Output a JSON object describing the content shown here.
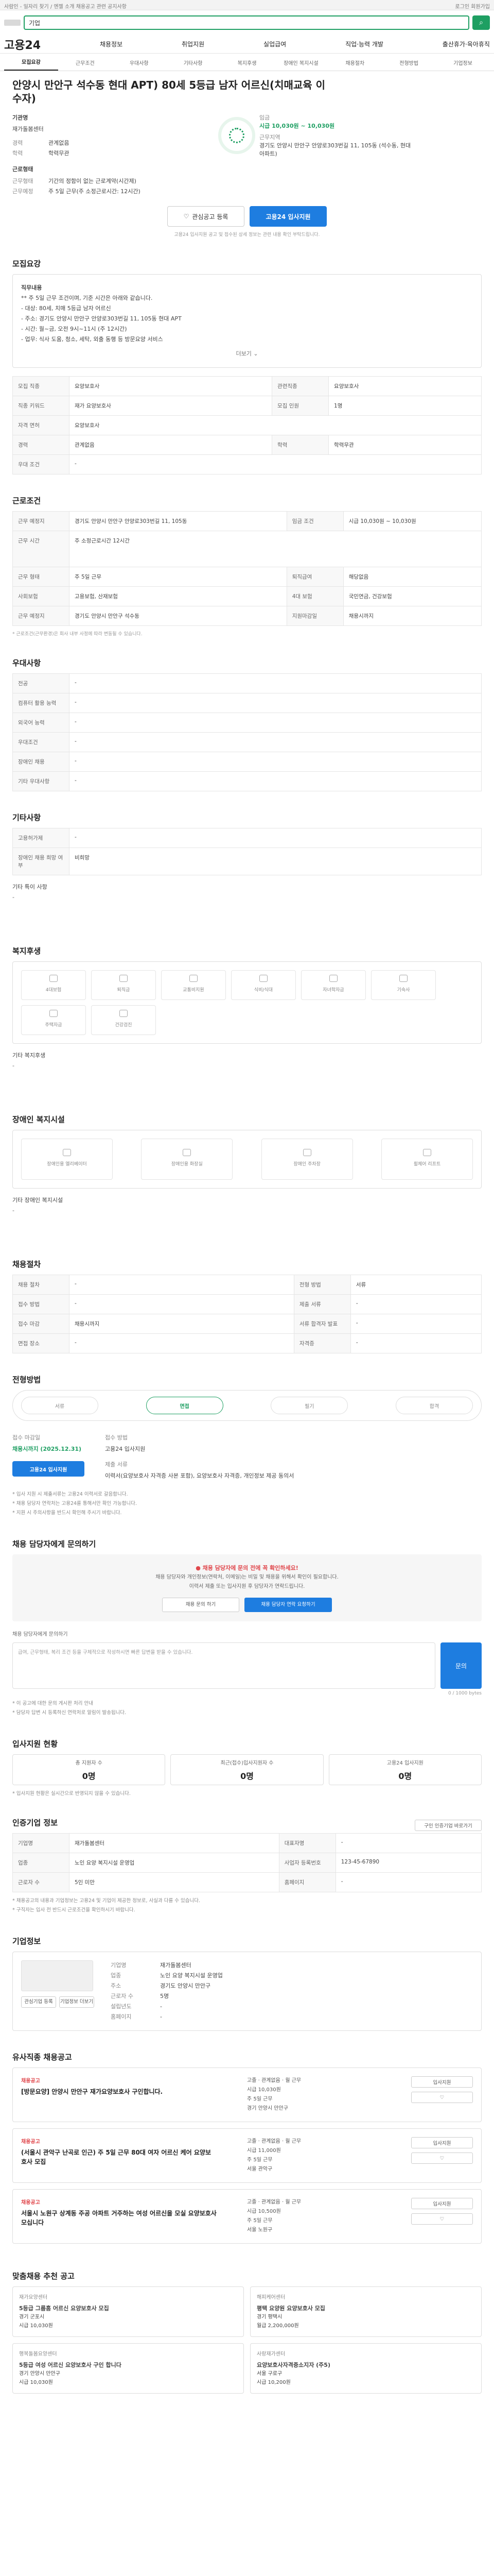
{
  "topbar": {
    "left": "사람인 - 일자리 찾기 / 엔젤 소개 채용공고 관련 공지사항",
    "right": "로그인  회원가입"
  },
  "search": {
    "placeholder": "기업",
    "button": "검색"
  },
  "gnb": {
    "brand": "고용24",
    "items": [
      "채용정보",
      "취업지원",
      "실업급여",
      "직업·능력 개발",
      "출산휴가·육아휴직"
    ]
  },
  "tabs": [
    {
      "label": "모집요강",
      "active": true
    },
    {
      "label": "근무조건",
      "active": false
    },
    {
      "label": "우대사항",
      "active": false
    },
    {
      "label": "기타사항",
      "active": false
    },
    {
      "label": "복지후생",
      "active": false
    },
    {
      "label": "장애인 복지시설",
      "active": false
    },
    {
      "label": "채용절차",
      "active": false
    },
    {
      "label": "전형방법",
      "active": false
    },
    {
      "label": "기업정보",
      "active": false
    }
  ],
  "header": {
    "title": "안양시 만안구 석수동 현대 APT) 80세 5등급 남자 어르신(치매교육 이수자)",
    "company_label": "기관명",
    "company_value": "재가돌봄센터",
    "rows": [
      {
        "k": "경력",
        "v": "관계없음"
      },
      {
        "k": "학력",
        "v": "학력무관"
      }
    ],
    "emp_label": "근로형태",
    "emp_rows": [
      {
        "k": "근무형태",
        "v": "기간의 정함이 없는 근로계약(시간제)"
      },
      {
        "k": "근무예정",
        "v": "주 5일 근무(주 소정근로시간: 12시간)"
      }
    ],
    "pay_label": "임금",
    "pay": "시급 10,030원 ~ 10,030원",
    "addr_label": "근무지역",
    "addr": "경기도 안양시 만안구 안양로303번길 11, 105동 (석수동, 현대아파트)",
    "save_btn": "관심공고 등록",
    "apply_btn": "고용24 입사지원",
    "note": "고용24 입사지원 공고 및 접수된 상세 정보는 관련 내용 확인 부탁드립니다."
  },
  "recruit": {
    "title": "모집요강",
    "lines": [
      "직무내용",
      "** 주 5일 근무 조건이며, 기준 시간은 아래와 같습니다.",
      "- 대상: 80세, 치매 5등급 남자 어르신",
      "- 주소: 경기도 안양시 만안구 안양로303번길 11, 105동 현대 APT",
      "- 시간: 월~금, 오전 9시~11시 (주 12시간)",
      "- 업무: 식사 도움, 청소, 세탁, 외출 동행 등 방문요양 서비스"
    ],
    "more": "더보기",
    "table": [
      [
        "모집 직종",
        "요양보호사",
        "관련직종",
        "요양보호사"
      ],
      [
        "직종 키워드",
        "재가 요양보호사",
        "모집 인원",
        "1명"
      ],
      [
        "자격 면허",
        "요양보호사",
        "",
        ""
      ],
      [
        "경력",
        "관계없음",
        "학력",
        "학력무관"
      ],
      [
        "우대 조건",
        "-",
        "",
        ""
      ]
    ]
  },
  "conditions": {
    "title": "근로조건",
    "table": [
      [
        "근무 예정지",
        "경기도 안양시 만안구 안양로303번길 11, 105동",
        "임금 조건",
        "시급 10,030원 ~ 10,030원"
      ],
      [
        "근무 시간",
        "주 소정근로시간 12시간",
        "",
        ""
      ],
      [
        "근무 형태",
        "주 5일 근무",
        "퇴직급여",
        "해당없음"
      ],
      [
        "사회보험",
        "고용보험, 산재보험",
        "4대 보험",
        "국민연금, 건강보험"
      ],
      [
        "근무 예정지",
        "경기도 안양시 만안구 석수동",
        "지원마감일",
        "채용시까지"
      ]
    ],
    "footnote": "* 근로조건(근무환경)은 회사 내부 사정에 따라 변동될 수 있습니다."
  },
  "prefer": {
    "title": "우대사항",
    "table": [
      [
        "전공",
        "-"
      ],
      [
        "컴퓨터 활용 능력",
        "-"
      ],
      [
        "외국어 능력",
        "-"
      ],
      [
        "우대조건",
        "-"
      ],
      [
        "장애인 채용",
        "-"
      ],
      [
        "기타 우대사항",
        "-"
      ]
    ]
  },
  "etc": {
    "title": "기타사항",
    "table": [
      [
        "고용허가제",
        "-"
      ],
      [
        "장애인 채용 희망 여부",
        "비희망"
      ]
    ],
    "sub": "기타 특이 사항",
    "sub_value": "-"
  },
  "welfare": {
    "title": "복지후생",
    "items": [
      "4대보험",
      "퇴직금",
      "교통비지원",
      "식비/식대",
      "자녀학자금",
      "기숙사",
      "주택자금",
      "건강검진"
    ],
    "etc_label": "기타 복지후생",
    "etc_value": "-"
  },
  "disability": {
    "title": "장애인 복지시설",
    "items": [
      "장애인용 엘리베이터",
      "장애인용 화장실",
      "장애인 주차장",
      "휠체어 리프트"
    ],
    "etc_label": "기타 장애인 복지시설",
    "etc_value": "-"
  },
  "process": {
    "title": "채용절차",
    "table": [
      [
        "채용 절차",
        "-",
        "전형 방법",
        "서류"
      ],
      [
        "접수 방법",
        "-",
        "제출 서류",
        "-"
      ],
      [
        "접수 마감",
        "채용시까지",
        "서류 합격자 발표",
        "-"
      ],
      [
        "면접 장소",
        "-",
        "자격증",
        "-"
      ]
    ]
  },
  "method": {
    "title": "전형방법",
    "steps": [
      "서류",
      "면접",
      "필기",
      "합격"
    ],
    "current": "면접",
    "apply_label": "접수 마감일",
    "apply_value": "채용시까지 (2025.12.31)",
    "method_label": "접수 방법",
    "method_value": "고용24 입사지원",
    "docs_label": "제출 서류",
    "docs_value": "이력서(요양보호사 자격증 사본 포함), 요양보호사 자격증, 개인정보 제공 동의서",
    "apply_btn": "고용24 입사지원",
    "notes": [
      "* 입사 지원 시 제출서류는 고용24 이력서로 갈음합니다.",
      "* 채용 담당자 연락처는 고용24를 통해서만 확인 가능합니다.",
      "* 지원 시 주의사항을 반드시 확인해 주시기 바랍니다."
    ]
  },
  "qa": {
    "title": "채용 담당자에게 문의하기",
    "banner_title": "채용 담당자에 문의 전에 꼭 확인하세요!",
    "banner_lines": [
      "채용 담당자와 개인정보(연락처, 이메일)는 비밀 및 채용을 위해서 확인이 필요합니다.",
      "이력서 제출 또는 입사지원 후 담당자가 연락드립니다."
    ],
    "banner_btn1": "채용 문의 하기",
    "banner_btn2": "채용 담당자 연락 요청하기",
    "box_label": "채용 담당자에게 문의하기",
    "placeholder": "급여, 근무형태, 복리 조건 등을 구체적으로 작성하시면 빠른 답변을 받을 수 있습니다.",
    "send": "문의",
    "count": "0 / 1000 bytes",
    "hints": [
      "* 이 공고에 대한 문의 게시판 처리 안내",
      "* 담당자 답변 시 등록하신 연락처로 알림이 발송됩니다."
    ]
  },
  "status": {
    "title": "입사지원 현황",
    "items": [
      {
        "label": "총 지원자 수",
        "value": "0명"
      },
      {
        "label": "최근(접수)입사지원자 수",
        "value": "0명"
      },
      {
        "label": "고용24 입사지원",
        "value": "0명"
      }
    ],
    "note": "* 입사지원 현황은 실시간으로 반영되지 않을 수 있습니다."
  },
  "info": {
    "title": "인증기업 정보",
    "btn": "구인 인증기업 바로가기",
    "table": [
      [
        "기업명",
        "재가돌봄센터",
        "대표자명",
        "-"
      ],
      [
        "업종",
        "노인 요양 복지시설 운영업",
        "사업자 등록번호",
        "123-45-67890"
      ],
      [
        "근로자 수",
        "5인 미만",
        "홈페이지",
        "-"
      ]
    ],
    "notes": [
      "* 채용공고의 내용과 기업정보는 고용24 및 기업이 제공한 정보로, 사실과 다를 수 있습니다.",
      "* 구직자는 입사 전 반드시 근로조건을 확인하시기 바랍니다."
    ]
  },
  "company": {
    "title": "기업정보",
    "name_label": "기업명",
    "name": "재가돌봄센터",
    "rows": [
      [
        "업종",
        "노인 요양 복지시설 운영업"
      ],
      [
        "주소",
        "경기도 안양시 만안구"
      ],
      [
        "근로자 수",
        "5명"
      ],
      [
        "설립년도",
        "-"
      ],
      [
        "홈페이지",
        "-"
      ]
    ],
    "actions": [
      "관심기업 등록",
      "기업정보 더보기"
    ]
  },
  "related": {
    "title": "유사직종 채용공고",
    "jobs": [
      {
        "tag": "채용공고",
        "title": "[방문요양] 안양시 만안구 재가요양보호사 구인합니다.",
        "mid": [
          "고졸",
          "관계없음",
          "월 근무",
          "시급 10,030원",
          "주 5일 근무",
          "경기 안양시 만안구"
        ],
        "btn": "입사지원"
      },
      {
        "tag": "채용공고",
        "title": "(서울시 관악구 난곡로 인근) 주 5일 근무 80대 여자 어르신 케어 요양보호사 모집",
        "mid": [
          "고졸",
          "관계없음",
          "월 근무",
          "시급 11,000원",
          "주 5일 근무",
          "서울 관악구"
        ],
        "btn": "입사지원"
      },
      {
        "tag": "채용공고",
        "title": "서울시 노원구 상계동 주공 아파트 거주하는 여성 어르신을 모실 요양보호사 모십니다",
        "mid": [
          "고졸",
          "관계없음",
          "월 근무",
          "시급 10,500원",
          "주 5일 근무",
          "서울 노원구"
        ],
        "btn": "입사지원"
      }
    ]
  },
  "recommend": {
    "title": "맞춤채용 추천 공고",
    "cards": [
      {
        "co": "재가요양센터",
        "title": "5등급 그룹홈 어르신 요양보호사 모집",
        "meta": [
          "경기 군포시",
          "시급 10,030원"
        ]
      },
      {
        "co": "해피케어센터",
        "title": "평택 요양원 요양보호사 모집",
        "meta": [
          "경기 평택시",
          "월급 2,200,000원"
        ]
      },
      {
        "co": "행복돌봄요양센터",
        "title": "5등급 여성 어르신 요양보호사 구인 합니다",
        "meta": [
          "경기 안양시 만안구",
          "시급 10,030원"
        ]
      },
      {
        "co": "사랑재가센터",
        "title": "요양보호사자격증소지자 (주5)",
        "meta": [
          "서울 구로구",
          "시급 10,200원"
        ]
      }
    ]
  }
}
